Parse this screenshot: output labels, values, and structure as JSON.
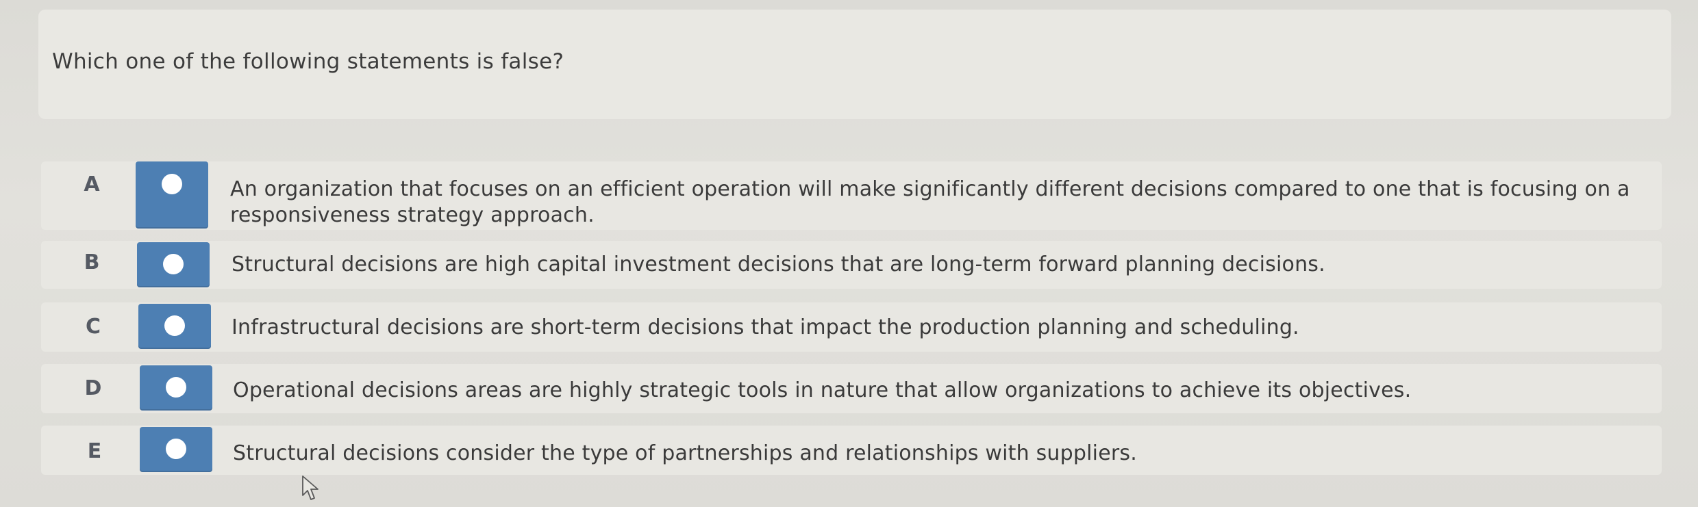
{
  "question": {
    "text": "Which one of the following statements is false?"
  },
  "options": [
    {
      "letter": "A",
      "text": "An organization that focuses on an efficient operation will make significantly different decisions compared to one that is focusing on a responsiveness strategy approach."
    },
    {
      "letter": "B",
      "text": "Structural decisions are high capital investment decisions that are long-term forward planning decisions."
    },
    {
      "letter": "C",
      "text": "Infrastructural decisions are short-term decisions that impact the production planning and scheduling."
    },
    {
      "letter": "D",
      "text": "Operational decisions areas are highly strategic tools in nature that allow organizations to achieve its objectives."
    },
    {
      "letter": "E",
      "text": "Structural decisions consider the type of partnerships and relationships with suppliers."
    }
  ],
  "colors": {
    "radio_box": "#4d7fb3",
    "radio_circle": "#ffffff",
    "background": "#dedcd7"
  },
  "icons": {
    "radio": "radio-button-icon",
    "cursor": "mouse-pointer-icon"
  }
}
